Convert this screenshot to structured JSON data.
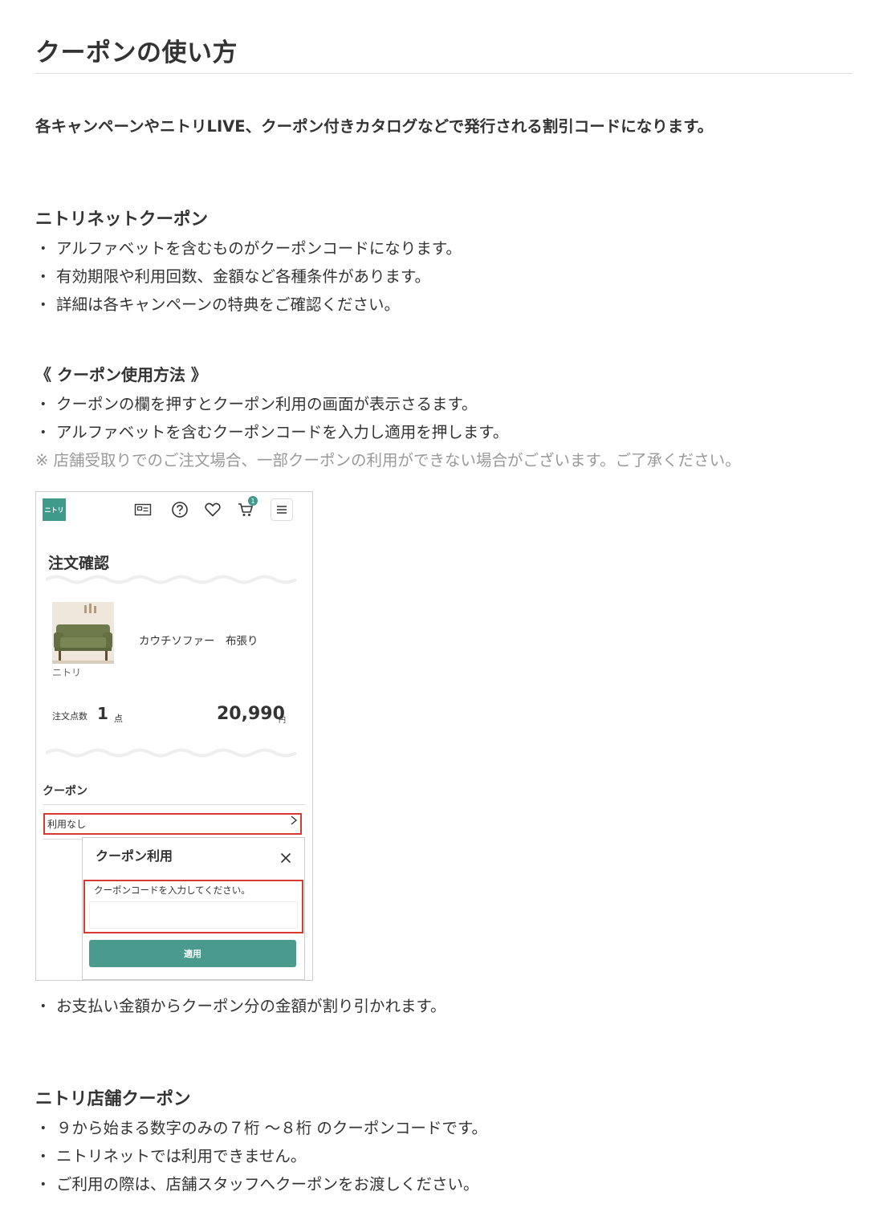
{
  "title": "クーポンの使い方",
  "intro": "各キャンペーンやニトリLIVE、クーポン付きカタログなどで発行される割引コードになります。",
  "bullet": "・",
  "net_section": {
    "heading": "ニトリネットクーポン",
    "items": [
      "アルファベットを含むものがクーポンコードになります。",
      "有効期限や利用回数、金額など各種条件があります。",
      "詳細は各キャンペーンの特典をご確認ください。"
    ]
  },
  "usage_section": {
    "heading": "《 クーポン使用方法 》",
    "items": [
      "クーポンの欄を押すとクーポン利用の画面が表示さるます。",
      "アルファベットを含むクーポンコードを入力し適用を押します。"
    ],
    "note": "※ 店舗受取りでのご注文場合、一部クーポンの利用ができない場合がございます。ご了承ください。",
    "after_item": "お支払い金額からクーポン分の金額が割り引かれます。"
  },
  "screenshot": {
    "logo": "ニトリ",
    "cart_badge": "1",
    "page_title": "注文確認",
    "product_name": "カウチソファー　布張り",
    "brand": "ニトリ",
    "qty_label": "注文点数",
    "qty_value": "1",
    "qty_unit": "点",
    "price": "20,990",
    "currency": "円",
    "coupon_heading": "クーポン",
    "coupon_value": "利用なし",
    "modal_title": "クーポン利用",
    "modal_label": "クーポンコードを入力してください。",
    "apply_label": "適用",
    "accent_color": "#3f9a8c",
    "highlight_color": "#d63a35"
  },
  "store_section": {
    "heading": "ニトリ店舗クーポン",
    "items": [
      "９から始まる数字のみの７桁 〜８桁 のクーポンコードです。",
      "ニトリネットでは利用できません。",
      "ご利用の際は、店舗スタッフへクーポンをお渡しください。"
    ]
  }
}
